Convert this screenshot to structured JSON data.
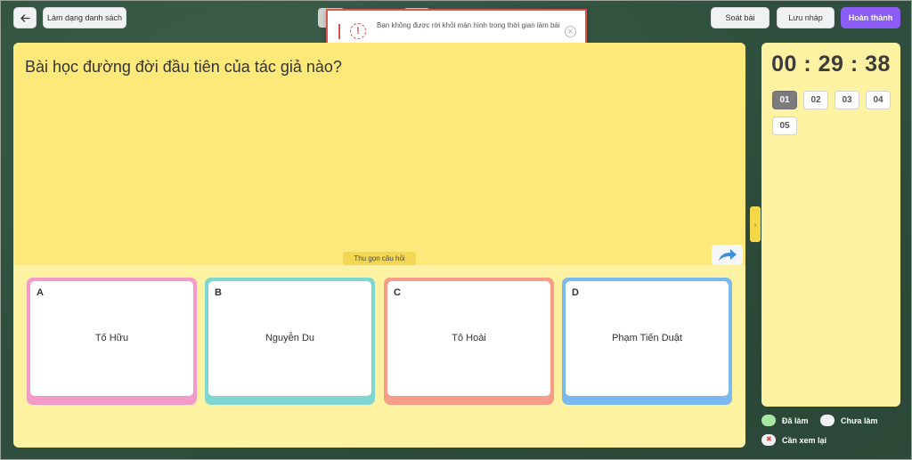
{
  "toolbar": {
    "back_icon": "arrow-left-icon",
    "list_label": "Làm dạng danh sách",
    "check_label": "Soát bài",
    "draft_label": "Lưu nháp",
    "finish_label": "Hoàn thành",
    "accent": "#8b5cf6"
  },
  "toast": {
    "message": "Bạn không được rời khỏi màn hình trong thời gian làm bài",
    "icon": "warning-icon",
    "close_icon": "close-icon",
    "color": "#d9534f"
  },
  "question": {
    "text": "Bài học đường đời đầu tiên của tác giả nào?",
    "collapse_label": "Thu gọn câu hỏi",
    "next_icon": "share-arrow-icon"
  },
  "options": [
    {
      "letter": "A",
      "text": "Tố Hữu",
      "color": "#f39ac8"
    },
    {
      "letter": "B",
      "text": "Nguyễn Du",
      "color": "#7dd6d0"
    },
    {
      "letter": "C",
      "text": "Tô Hoài",
      "color": "#f69c88"
    },
    {
      "letter": "D",
      "text": "Phạm Tiến Duật",
      "color": "#7ab8f0"
    }
  ],
  "sidebar": {
    "toggle_icon": "chevron-right-icon",
    "timer": "00 : 29 : 38",
    "questions": [
      "01",
      "02",
      "03",
      "04",
      "05"
    ],
    "active_question": "01"
  },
  "legend": {
    "done": {
      "label": "Đã làm",
      "color": "#a8e6a3"
    },
    "todo": {
      "label": "Chưa làm",
      "color": "#f1f2f4"
    },
    "review": {
      "label": "Cần xem lại",
      "color": "#f1f2f4"
    }
  }
}
